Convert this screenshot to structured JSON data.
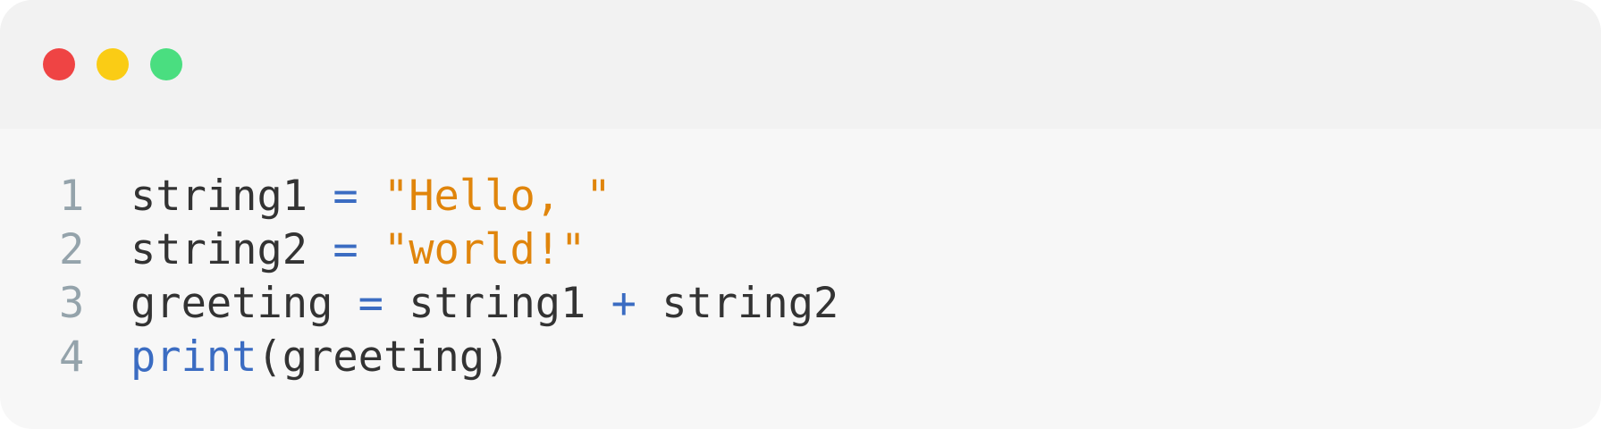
{
  "window": {
    "controls": {
      "close_color": "#ef4444",
      "minimize_color": "#facc15",
      "maximize_color": "#4ade80"
    }
  },
  "editor": {
    "lines": [
      {
        "number": "1",
        "tokens": [
          {
            "type": "id",
            "text": "string1"
          },
          {
            "type": "space",
            "text": " "
          },
          {
            "type": "op",
            "text": "="
          },
          {
            "type": "space",
            "text": " "
          },
          {
            "type": "str",
            "text": "\"Hello, \""
          }
        ]
      },
      {
        "number": "2",
        "tokens": [
          {
            "type": "id",
            "text": "string2"
          },
          {
            "type": "space",
            "text": " "
          },
          {
            "type": "op",
            "text": "="
          },
          {
            "type": "space",
            "text": " "
          },
          {
            "type": "str",
            "text": "\"world!\""
          }
        ]
      },
      {
        "number": "3",
        "tokens": [
          {
            "type": "id",
            "text": "greeting"
          },
          {
            "type": "space",
            "text": " "
          },
          {
            "type": "op",
            "text": "="
          },
          {
            "type": "space",
            "text": " "
          },
          {
            "type": "id",
            "text": "string1"
          },
          {
            "type": "space",
            "text": " "
          },
          {
            "type": "op",
            "text": "+"
          },
          {
            "type": "space",
            "text": " "
          },
          {
            "type": "id",
            "text": "string2"
          }
        ]
      },
      {
        "number": "4",
        "tokens": [
          {
            "type": "kw",
            "text": "print"
          },
          {
            "type": "id",
            "text": "(greeting)"
          }
        ]
      }
    ]
  }
}
